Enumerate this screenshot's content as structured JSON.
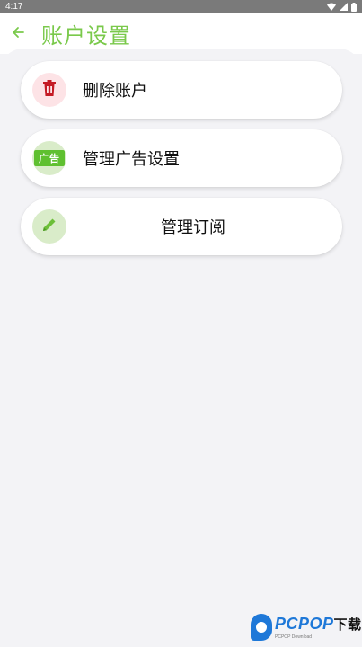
{
  "status_bar": {
    "time": "4:17",
    "icons": [
      "wifi-icon",
      "signal-icon",
      "battery-icon"
    ]
  },
  "header": {
    "back_icon": "arrow-left-icon",
    "title": "账户设置"
  },
  "items": [
    {
      "label": "删除账户",
      "icon": "trash-icon",
      "icon_color": "#c41a24",
      "icon_bg": "#fde3e6"
    },
    {
      "label": "管理广告设置",
      "icon": "ad-badge-icon",
      "icon_text": "广告",
      "icon_color": "#5fc030",
      "icon_bg": "#d9ecc9"
    },
    {
      "label": "管理订阅",
      "icon": "pencil-icon",
      "icon_color": "#6cbf38",
      "icon_bg": "#d9ecc9"
    }
  ],
  "watermark": {
    "brand": "PCPOP",
    "suffix": "下载",
    "sub": "PCPOP Download"
  },
  "colors": {
    "accent": "#7ac94b",
    "background": "#f3f3f6",
    "card": "#ffffff"
  }
}
